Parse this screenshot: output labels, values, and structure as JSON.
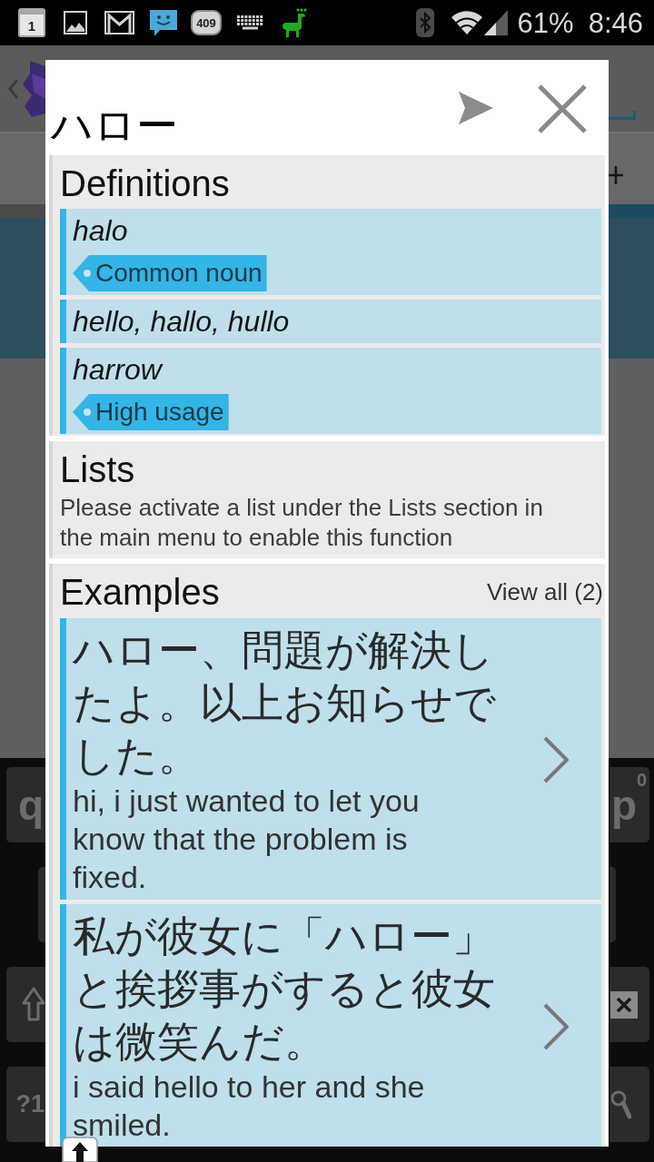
{
  "status_bar": {
    "calendar_day": "1",
    "message_count": "409",
    "battery": "61%",
    "time": "8:46"
  },
  "background_app": {
    "keyboard": {
      "left_keys": [
        {
          "kind": "letter",
          "label": "q"
        },
        {
          "kind": "blank"
        },
        {
          "kind": "shift"
        },
        {
          "kind": "symbols",
          "label": "?1"
        }
      ],
      "right_keys": [
        {
          "kind": "letter",
          "label": "p",
          "hint": "0"
        },
        {
          "kind": "blank"
        },
        {
          "kind": "backspace"
        },
        {
          "kind": "search"
        }
      ]
    }
  },
  "dialog": {
    "title": "ハロー",
    "definitions": {
      "heading": "Definitions",
      "items": [
        {
          "text": "halo",
          "tag": "Common noun"
        },
        {
          "text": "hello, hallo, hullo"
        },
        {
          "text": "harrow",
          "tag": "High usage"
        }
      ]
    },
    "lists": {
      "heading": "Lists",
      "message": "Please activate a list under the Lists section in the main menu to enable this function"
    },
    "examples": {
      "heading": "Examples",
      "view_all": "View all (2)",
      "items": [
        {
          "japanese": "ハロー、問題が解決したよ。以上お知らせでした。",
          "english": "hi, i just wanted to let you know that the problem is fixed."
        },
        {
          "japanese": "私が彼女に「ハロー」と挨拶事がすると彼女は微笑んだ。",
          "english": "i said hello to her and she smiled."
        }
      ]
    }
  }
}
